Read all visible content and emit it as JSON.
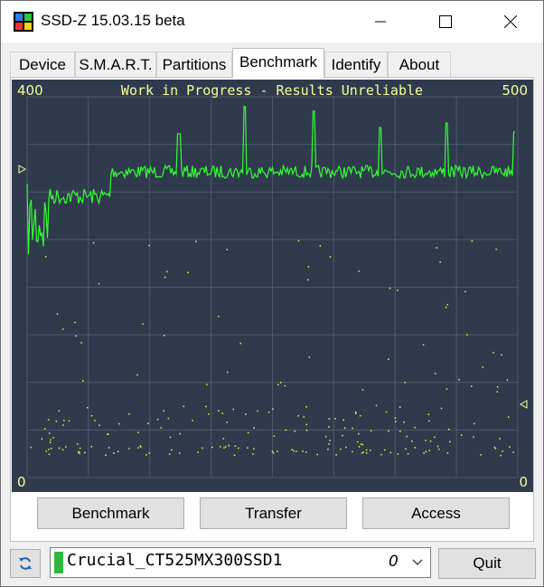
{
  "window": {
    "title": "SSD-Z 15.03.15 beta",
    "controls": [
      "minimize",
      "maximize",
      "close"
    ]
  },
  "tabs": [
    {
      "label": "Device",
      "active": false
    },
    {
      "label": "S.M.A.R.T.",
      "active": false
    },
    {
      "label": "Partitions",
      "active": false
    },
    {
      "label": "Benchmark",
      "active": true
    },
    {
      "label": "Identify",
      "active": false
    },
    {
      "label": "About",
      "active": false
    }
  ],
  "benchmark": {
    "status_text": "Work in Progress - Results Unreliable",
    "left_top_label": "400",
    "right_top_label": "500",
    "left_bottom_label": "0",
    "right_bottom_label": "0",
    "colors": {
      "background": "#2f3b4d",
      "grid": "#4a5a6c",
      "series_main": "#33ff33",
      "series_points": "#e6ff33",
      "text": "#f3ff9a"
    }
  },
  "buttons": {
    "benchmark": "Benchmark",
    "transfer": "Transfer",
    "access": "Access"
  },
  "footer": {
    "refresh_icon": "refresh-icon",
    "drive_name": "Crucial_CT525MX300SSD1",
    "drive_index": "0",
    "quit_label": "Quit"
  }
}
